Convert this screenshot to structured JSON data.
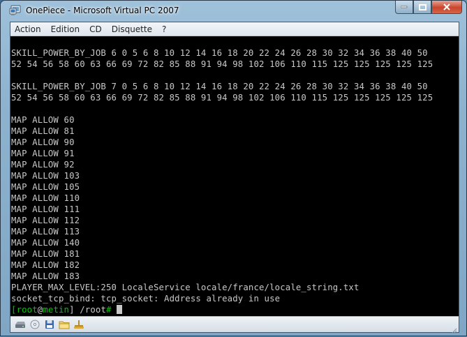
{
  "window": {
    "title": "OnePiece - Microsoft Virtual PC 2007",
    "minimize_label": "minimize",
    "maximize_label": "maximize",
    "close_label": "close"
  },
  "menu": [
    {
      "label": "Action"
    },
    {
      "label": "Edition"
    },
    {
      "label": "CD"
    },
    {
      "label": "Disquette"
    },
    {
      "label": "?"
    }
  ],
  "console": {
    "lines": [
      "",
      "SKILL_POWER_BY_JOB 6 0 5 6 8 10 12 14 16 18 20 22 24 26 28 30 32 34 36 38 40 50",
      "52 54 56 58 60 63 66 69 72 82 85 88 91 94 98 102 106 110 115 125 125 125 125 125",
      "",
      "SKILL_POWER_BY_JOB 7 0 5 6 8 10 12 14 16 18 20 22 24 26 28 30 32 34 36 38 40 50",
      "52 54 56 58 60 63 66 69 72 82 85 88 91 94 98 102 106 110 115 125 125 125 125 125",
      "",
      "MAP ALLOW 60",
      "MAP ALLOW 81",
      "MAP ALLOW 90",
      "MAP ALLOW 91",
      "MAP ALLOW 92",
      "MAP ALLOW 103",
      "MAP ALLOW 105",
      "MAP ALLOW 110",
      "MAP ALLOW 111",
      "MAP ALLOW 112",
      "MAP ALLOW 113",
      "MAP ALLOW 140",
      "MAP ALLOW 181",
      "MAP ALLOW 182",
      "MAP ALLOW 183",
      "PLAYER_MAX_LEVEL:250 LocaleService locale/france/locale_string.txt",
      "socket_tcp_bind: tcp_socket: Address already in use"
    ],
    "prompt": {
      "open": "[",
      "user": "root",
      "at": "@",
      "host": "metin",
      "path": "] /root",
      "symbol": "# "
    }
  },
  "status_icons": [
    "hard-disk-icon",
    "cd-drive-icon",
    "floppy-icon",
    "shared-folder-icon",
    "network-icon"
  ],
  "colors": {
    "console_bg": "#000000",
    "console_text": "#c8c8c8",
    "prompt_green": "#00c800",
    "close_button": "#c9452b"
  }
}
